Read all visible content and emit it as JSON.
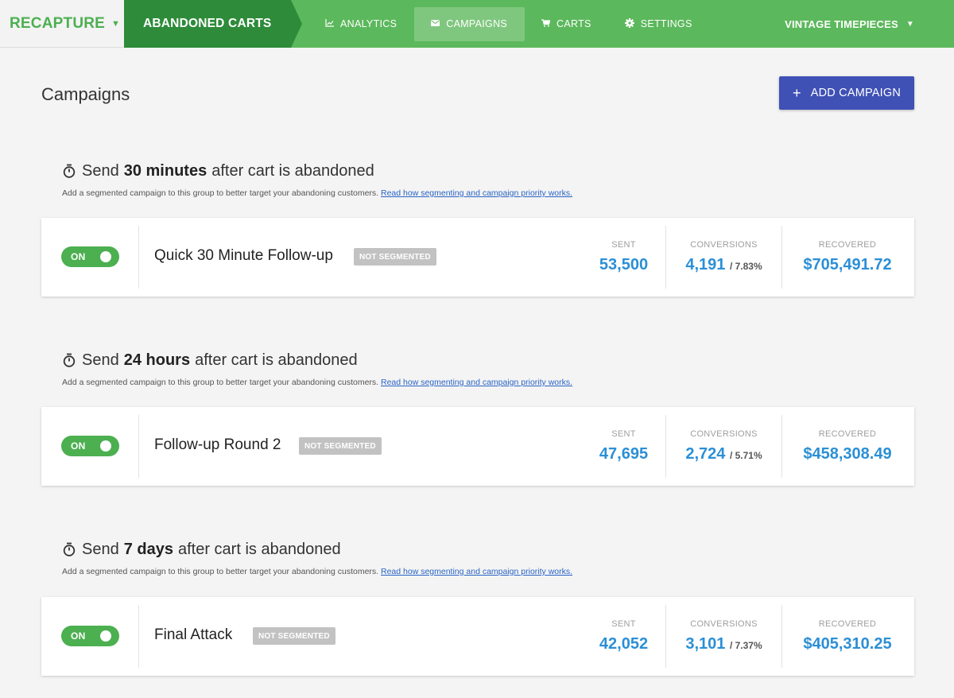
{
  "nav": {
    "brand": "RECAPTURE",
    "section": "ABANDONED CARTS",
    "links": [
      {
        "label": "ANALYTICS",
        "icon": "analytics-icon"
      },
      {
        "label": "CAMPAIGNS",
        "icon": "mail-icon"
      },
      {
        "label": "CARTS",
        "icon": "cart-icon"
      },
      {
        "label": "SETTINGS",
        "icon": "gear-icon"
      }
    ],
    "store": "VINTAGE TIMEPIECES"
  },
  "page": {
    "title": "Campaigns",
    "add_button": "ADD CAMPAIGN"
  },
  "groups": [
    {
      "prefix": "Send",
      "delay": "30 minutes",
      "suffix": "after cart is abandoned",
      "subtext": "Add a segmented campaign to this group to better target your abandoning customers.",
      "link": "Read how segmenting and campaign priority works.",
      "campaign": {
        "toggle": "ON",
        "name": "Quick 30 Minute Follow-up",
        "badge": "NOT SEGMENTED",
        "sent_label": "SENT",
        "sent": "53,500",
        "conversions_label": "CONVERSIONS",
        "conversions": "4,191",
        "conversion_rate": "/ 7.83%",
        "recovered_label": "RECOVERED",
        "recovered": "$705,491.72"
      }
    },
    {
      "prefix": "Send",
      "delay": "24 hours",
      "suffix": "after cart is abandoned",
      "subtext": "Add a segmented campaign to this group to better target your abandoning customers.",
      "link": "Read how segmenting and campaign priority works.",
      "campaign": {
        "toggle": "ON",
        "name": "Follow-up Round 2",
        "badge": "NOT SEGMENTED",
        "sent_label": "SENT",
        "sent": "47,695",
        "conversions_label": "CONVERSIONS",
        "conversions": "2,724",
        "conversion_rate": "/ 5.71%",
        "recovered_label": "RECOVERED",
        "recovered": "$458,308.49"
      }
    },
    {
      "prefix": "Send",
      "delay": "7 days",
      "suffix": "after cart is abandoned",
      "subtext": "Add a segmented campaign to this group to better target your abandoning customers.",
      "link": "Read how segmenting and campaign priority works.",
      "campaign": {
        "toggle": "ON",
        "name": "Final Attack",
        "badge": "NOT SEGMENTED",
        "sent_label": "SENT",
        "sent": "42,052",
        "conversions_label": "CONVERSIONS",
        "conversions": "3,101",
        "conversion_rate": "/ 7.37%",
        "recovered_label": "RECOVERED",
        "recovered": "$405,310.25"
      }
    }
  ],
  "colors": {
    "nav_green": "#5cb85c",
    "section_green": "#2e8b3a",
    "toggle_green": "#4caf50",
    "stat_blue": "#2b8fd6",
    "button_indigo": "#3f51b5"
  }
}
